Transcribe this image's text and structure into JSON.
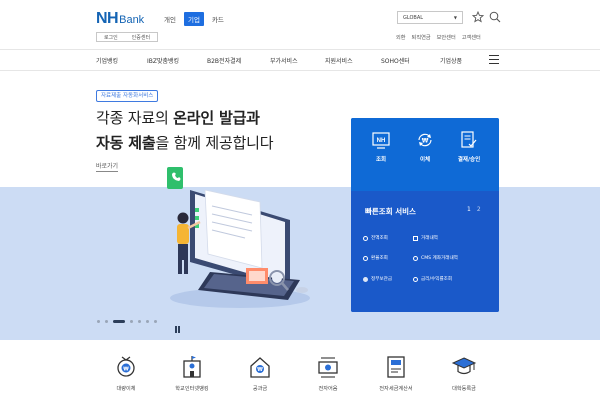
{
  "header": {
    "logo_nh": "NH",
    "logo_bank": "Bank",
    "segments": [
      "개인",
      "기업",
      "카드"
    ],
    "active_segment": "기업",
    "sub_buttons": [
      "로그인",
      "인증센터"
    ],
    "language": "GLOBAL",
    "utility_links": [
      "외환",
      "퇴직연금",
      "보안센터",
      "고객센터"
    ]
  },
  "nav": {
    "items": [
      "기업뱅킹",
      "IBZ맞춤뱅킹",
      "B2B전자결제",
      "부가서비스",
      "지원서비스",
      "SOHO센터",
      "기업상품"
    ]
  },
  "hero": {
    "tag": "자료제출 자동화서비스",
    "line1_plain": "각종 자료의 ",
    "line1_bold": "온라인 발급과",
    "line2_bold": "자동 제출",
    "line2_plain": "을 함께 제공합니다",
    "shortcut": "바로가기",
    "slides_total": 7,
    "slide_active": 3
  },
  "quick_panel": {
    "buttons": [
      {
        "label": "조회",
        "icon": "nh-card-icon"
      },
      {
        "label": "이체",
        "icon": "won-transfer-icon"
      },
      {
        "label": "결재/승인",
        "icon": "approval-icon"
      }
    ],
    "title": "빠른조회 서비스",
    "pages": [
      "1",
      "2"
    ],
    "items": [
      {
        "label": "전액조회",
        "icon": "circle"
      },
      {
        "label": "거래내역",
        "icon": "square"
      },
      {
        "label": "환율조회",
        "icon": "circle"
      },
      {
        "label": "CMS 계좌거래내역",
        "icon": "circle"
      },
      {
        "label": "정부보관금",
        "icon": "dot"
      },
      {
        "label": "금리/수익률조회",
        "icon": "circle"
      }
    ]
  },
  "services": [
    {
      "label": "대량이체",
      "icon": "bulk-transfer-icon"
    },
    {
      "label": "학교인터넷뱅킹",
      "icon": "school-bank-icon"
    },
    {
      "label": "공과금",
      "icon": "utility-bill-icon"
    },
    {
      "label": "전자어음",
      "icon": "e-bill-icon"
    },
    {
      "label": "전자세금계산서",
      "icon": "e-tax-invoice-icon"
    },
    {
      "label": "대학등록금",
      "icon": "tuition-icon"
    }
  ],
  "colors": {
    "brand_blue": "#1464b4",
    "panel_blue": "#0f6ad6",
    "panel_blue_dark": "#1a59c9",
    "hero_band": "#ccdcf4",
    "accent_blue": "#1e6ee0"
  }
}
